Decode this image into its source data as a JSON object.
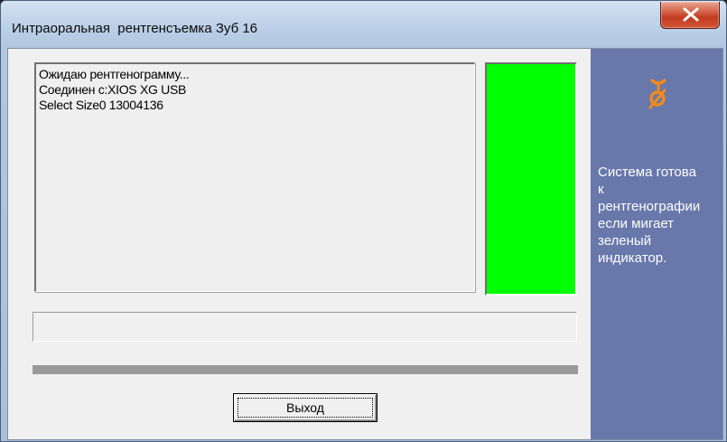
{
  "window": {
    "title": "Интраоральная  рентгенсъемка Зуб 16",
    "close_label": "x"
  },
  "log": {
    "lines": [
      "Ожидаю рентгенограмму...",
      "Соединен с:XIOS XG USB",
      "Select Size0 13004136"
    ]
  },
  "indicator": {
    "color": "#00ff00",
    "state": "ready"
  },
  "buttons": {
    "exit_label": "Выход"
  },
  "side_panel": {
    "icon": "disconnected-plug-icon",
    "icon_color": "#f08a1c",
    "background": "#6878ab",
    "message": "Система готова\nк\nрентгенографии\nесли мигает\nзеленый\nиндикатор."
  }
}
